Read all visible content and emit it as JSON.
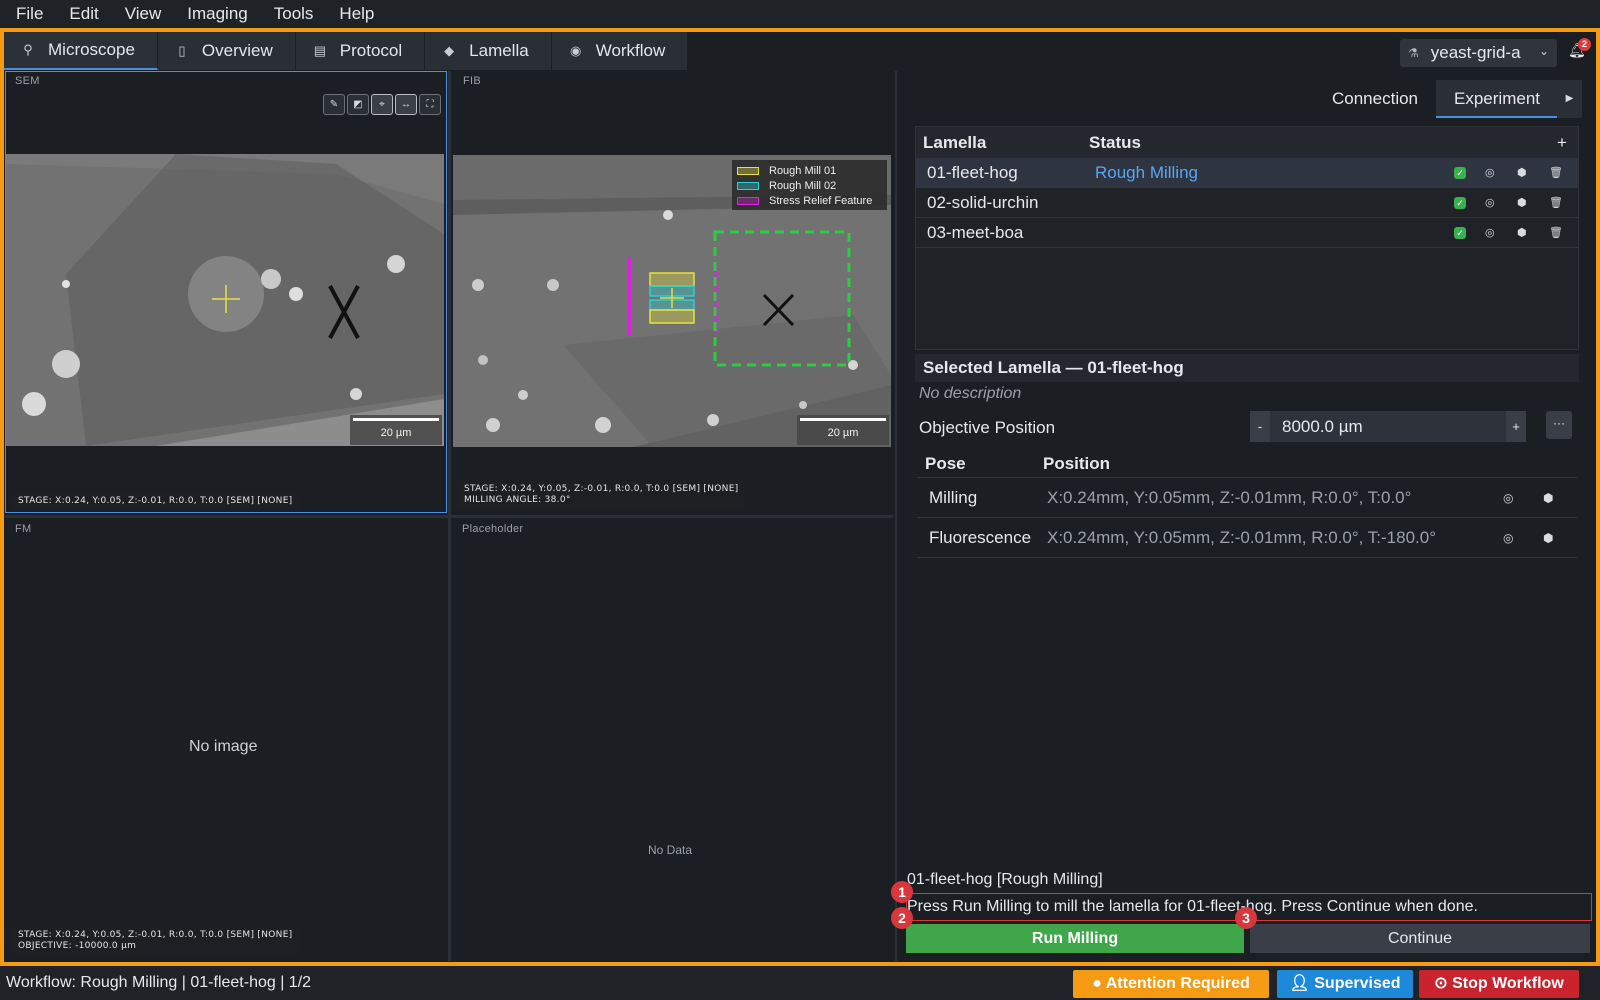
{
  "menu": [
    "File",
    "Edit",
    "View",
    "Imaging",
    "Tools",
    "Help"
  ],
  "tabs": [
    {
      "label": "Microscope",
      "icon": "microscope-icon"
    },
    {
      "label": "Overview",
      "icon": "map-icon"
    },
    {
      "label": "Protocol",
      "icon": "document-icon"
    },
    {
      "label": "Lamella",
      "icon": "layers-icon"
    },
    {
      "label": "Workflow",
      "icon": "play-circle-icon"
    }
  ],
  "grid_selector": {
    "value": "yeast-grid-a"
  },
  "notifications": {
    "count": "2"
  },
  "panels": {
    "sem": {
      "label": "SEM",
      "scale": "20 µm",
      "stage": "STAGE: X:0.24, Y:0.05, Z:-0.01, R:0.0, T:0.0 [SEM] [NONE]"
    },
    "fib": {
      "label": "FIB",
      "scale": "20 µm",
      "stage": "STAGE: X:0.24, Y:0.05, Z:-0.01, R:0.0, T:0.0 [SEM] [NONE]",
      "angle": "MILLING ANGLE: 38.0°",
      "legend": [
        {
          "name": "Rough Mill 01",
          "color": "#e7e23a"
        },
        {
          "name": "Rough Mill 02",
          "color": "#28d2d8"
        },
        {
          "name": "Stress Relief Feature",
          "color": "#e21fe6"
        }
      ]
    },
    "fm": {
      "label": "FM",
      "empty": "No image",
      "stage": "STAGE: X:0.24, Y:0.05, Z:-0.01, R:0.0, T:0.0 [SEM] [NONE]",
      "objective": "OBJECTIVE: -10000.0 µm"
    },
    "placeholder": {
      "label": "Placeholder",
      "empty": "No Data"
    }
  },
  "right_tabs": [
    "Connection",
    "Experiment"
  ],
  "lamella_table": {
    "headers": {
      "name": "Lamella",
      "status": "Status",
      "add": "+"
    },
    "rows": [
      {
        "name": "01-fleet-hog",
        "status": "Rough Milling"
      },
      {
        "name": "02-solid-urchin",
        "status": ""
      },
      {
        "name": "03-meet-boa",
        "status": ""
      }
    ]
  },
  "selected": {
    "title": "Selected Lamella — 01-fleet-hog",
    "description": "No description",
    "objective_label": "Objective Position",
    "objective_value": "8000.0 µm",
    "minus": "-",
    "plus": "+",
    "more": "···",
    "pose_headers": {
      "pose": "Pose",
      "position": "Position"
    },
    "poses": [
      {
        "name": "Milling",
        "position": "X:0.24mm, Y:0.05mm, Z:-0.01mm, R:0.0°, T:0.0°"
      },
      {
        "name": "Fluorescence",
        "position": "X:0.24mm, Y:0.05mm, Z:-0.01mm, R:0.0°, T:-180.0°"
      }
    ]
  },
  "workflow": {
    "title": "01-fleet-hog [Rough Milling]",
    "message": "Press Run Milling to mill the lamella for 01-fleet-hog. Press Continue when done.",
    "run_label": "Run Milling",
    "continue_label": "Continue",
    "markers": [
      "1",
      "2",
      "3"
    ]
  },
  "status": {
    "text": "Workflow: Rough Milling | 01-fleet-hog | 1/2",
    "attention": "Attention Required",
    "supervised": "Supervised",
    "stop": "Stop Workflow",
    "colors": {
      "attention": "#f59a13",
      "supervised": "#1e88d9",
      "stop": "#c9242d",
      "frame": "#f59a13",
      "accent": "#4a90e2"
    }
  }
}
